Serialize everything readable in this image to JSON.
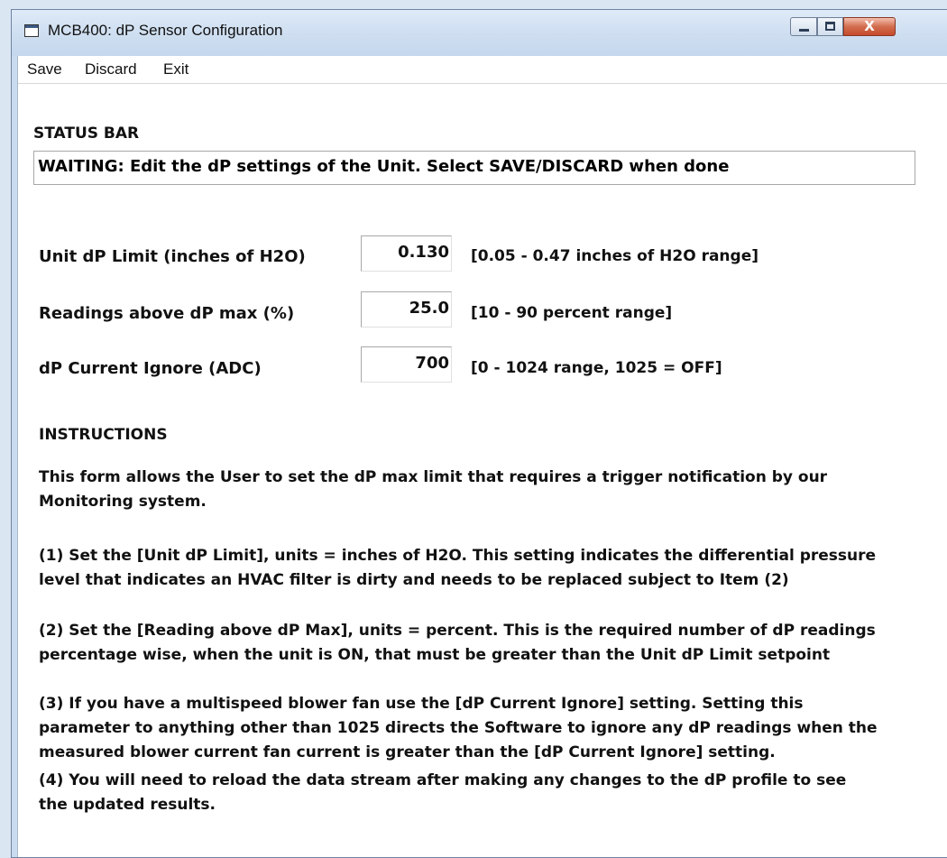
{
  "window": {
    "title": "MCB400: dP Sensor Configuration",
    "close_symbol": "X"
  },
  "menu": {
    "items": [
      "Save",
      "Discard",
      "Exit"
    ]
  },
  "status": {
    "heading": "STATUS BAR",
    "text": "WAITING: Edit the dP settings of the Unit. Select SAVE/DISCARD when done"
  },
  "fields": [
    {
      "label": "Unit dP Limit (inches of H2O)",
      "value": "0.130",
      "range": "[0.05 - 0.47 inches of H2O range]"
    },
    {
      "label": "Readings above dP max (%)",
      "value": "25.0",
      "range": "[10 - 90 percent range]"
    },
    {
      "label": "dP Current Ignore (ADC)",
      "value": "700",
      "range": "[0 - 1024 range, 1025 = OFF]"
    }
  ],
  "instructions": {
    "heading": "INSTRUCTIONS",
    "intro_lines": [
      "This form allows the User to set the dP max limit that requires a trigger notification by our",
      "Monitoring system."
    ],
    "item1_lines": [
      "(1) Set the [Unit dP Limit], units = inches of H2O. This setting indicates the differential pressure",
      "level that indicates an HVAC filter is dirty and needs to be replaced subject to Item (2)"
    ],
    "item2_lines": [
      "(2) Set the [Reading above dP Max], units = percent. This is the required number of dP readings",
      "percentage wise, when the unit is ON, that must be greater than the Unit dP Limit setpoint"
    ],
    "item3_lines": [
      "(3) If you have a multispeed blower fan use the [dP Current Ignore] setting. Setting this",
      "parameter to anything other than 1025 directs the Software to ignore any dP readings when the",
      "measured blower current fan current is greater than the [dP Current Ignore] setting."
    ],
    "item4_lines": [
      "(4) You will need to reload the data stream after making any changes to the dP profile to see",
      "the updated results."
    ]
  }
}
